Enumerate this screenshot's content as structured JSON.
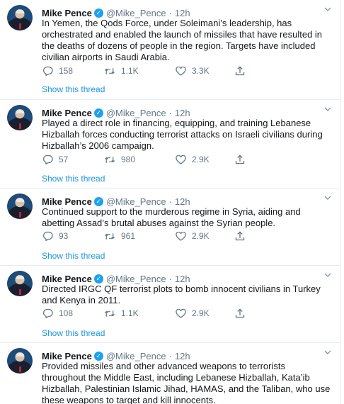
{
  "tweets": [
    {
      "name": "Mike Pence",
      "handle": "@Mike_Pence",
      "time": "12h",
      "text": "In Yemen, the Qods Force, under Soleimani’s leadership, has orchestrated and enabled the launch of missiles that have resulted in the deaths of dozens of people in the region.  Targets have included civilian airports in Saudi Arabia.",
      "replies": "158",
      "retweets": "1.1K",
      "likes": "3.3K",
      "show_thread": "Show this thread"
    },
    {
      "name": "Mike Pence",
      "handle": "@Mike_Pence",
      "time": "12h",
      "text": "Played a direct role in financing, equipping, and training Lebanese Hizballah forces conducting terrorist attacks on Israeli civilians during Hizballah’s 2006 campaign.",
      "replies": "57",
      "retweets": "980",
      "likes": "2.9K",
      "show_thread": "Show this thread"
    },
    {
      "name": "Mike Pence",
      "handle": "@Mike_Pence",
      "time": "12h",
      "text": "Continued support to the murderous regime in Syria, aiding and abetting Assad’s brutal abuses against the Syrian people.",
      "replies": "93",
      "retweets": "961",
      "likes": "2.9K",
      "show_thread": "Show this thread"
    },
    {
      "name": "Mike Pence",
      "handle": "@Mike_Pence",
      "time": "12h",
      "text": "Directed IRGC QF terrorist plots to bomb innocent civilians in Turkey and Kenya in 2011.",
      "replies": "108",
      "retweets": "1.1K",
      "likes": "2.9K",
      "show_thread": "Show this thread"
    },
    {
      "name": "Mike Pence",
      "handle": "@Mike_Pence",
      "time": "12h",
      "text": "Provided missiles and other advanced weapons to terrorists throughout the Middle East, including Lebanese Hizballah, Kata’ib Hizballah, Palestinian Islamic Jihad, HAMAS, and the Taliban, who use these weapons to target and kill innocents."
    }
  ],
  "icons": {
    "verified": "verified-badge-icon",
    "caret": "chevron-down-icon",
    "reply": "reply-icon",
    "retweet": "retweet-icon",
    "like": "heart-icon",
    "share": "share-icon"
  },
  "colors": {
    "link": "#1b95e0",
    "verified": "#1da1f2",
    "muted": "#657786",
    "divider": "#e6ecf0"
  }
}
